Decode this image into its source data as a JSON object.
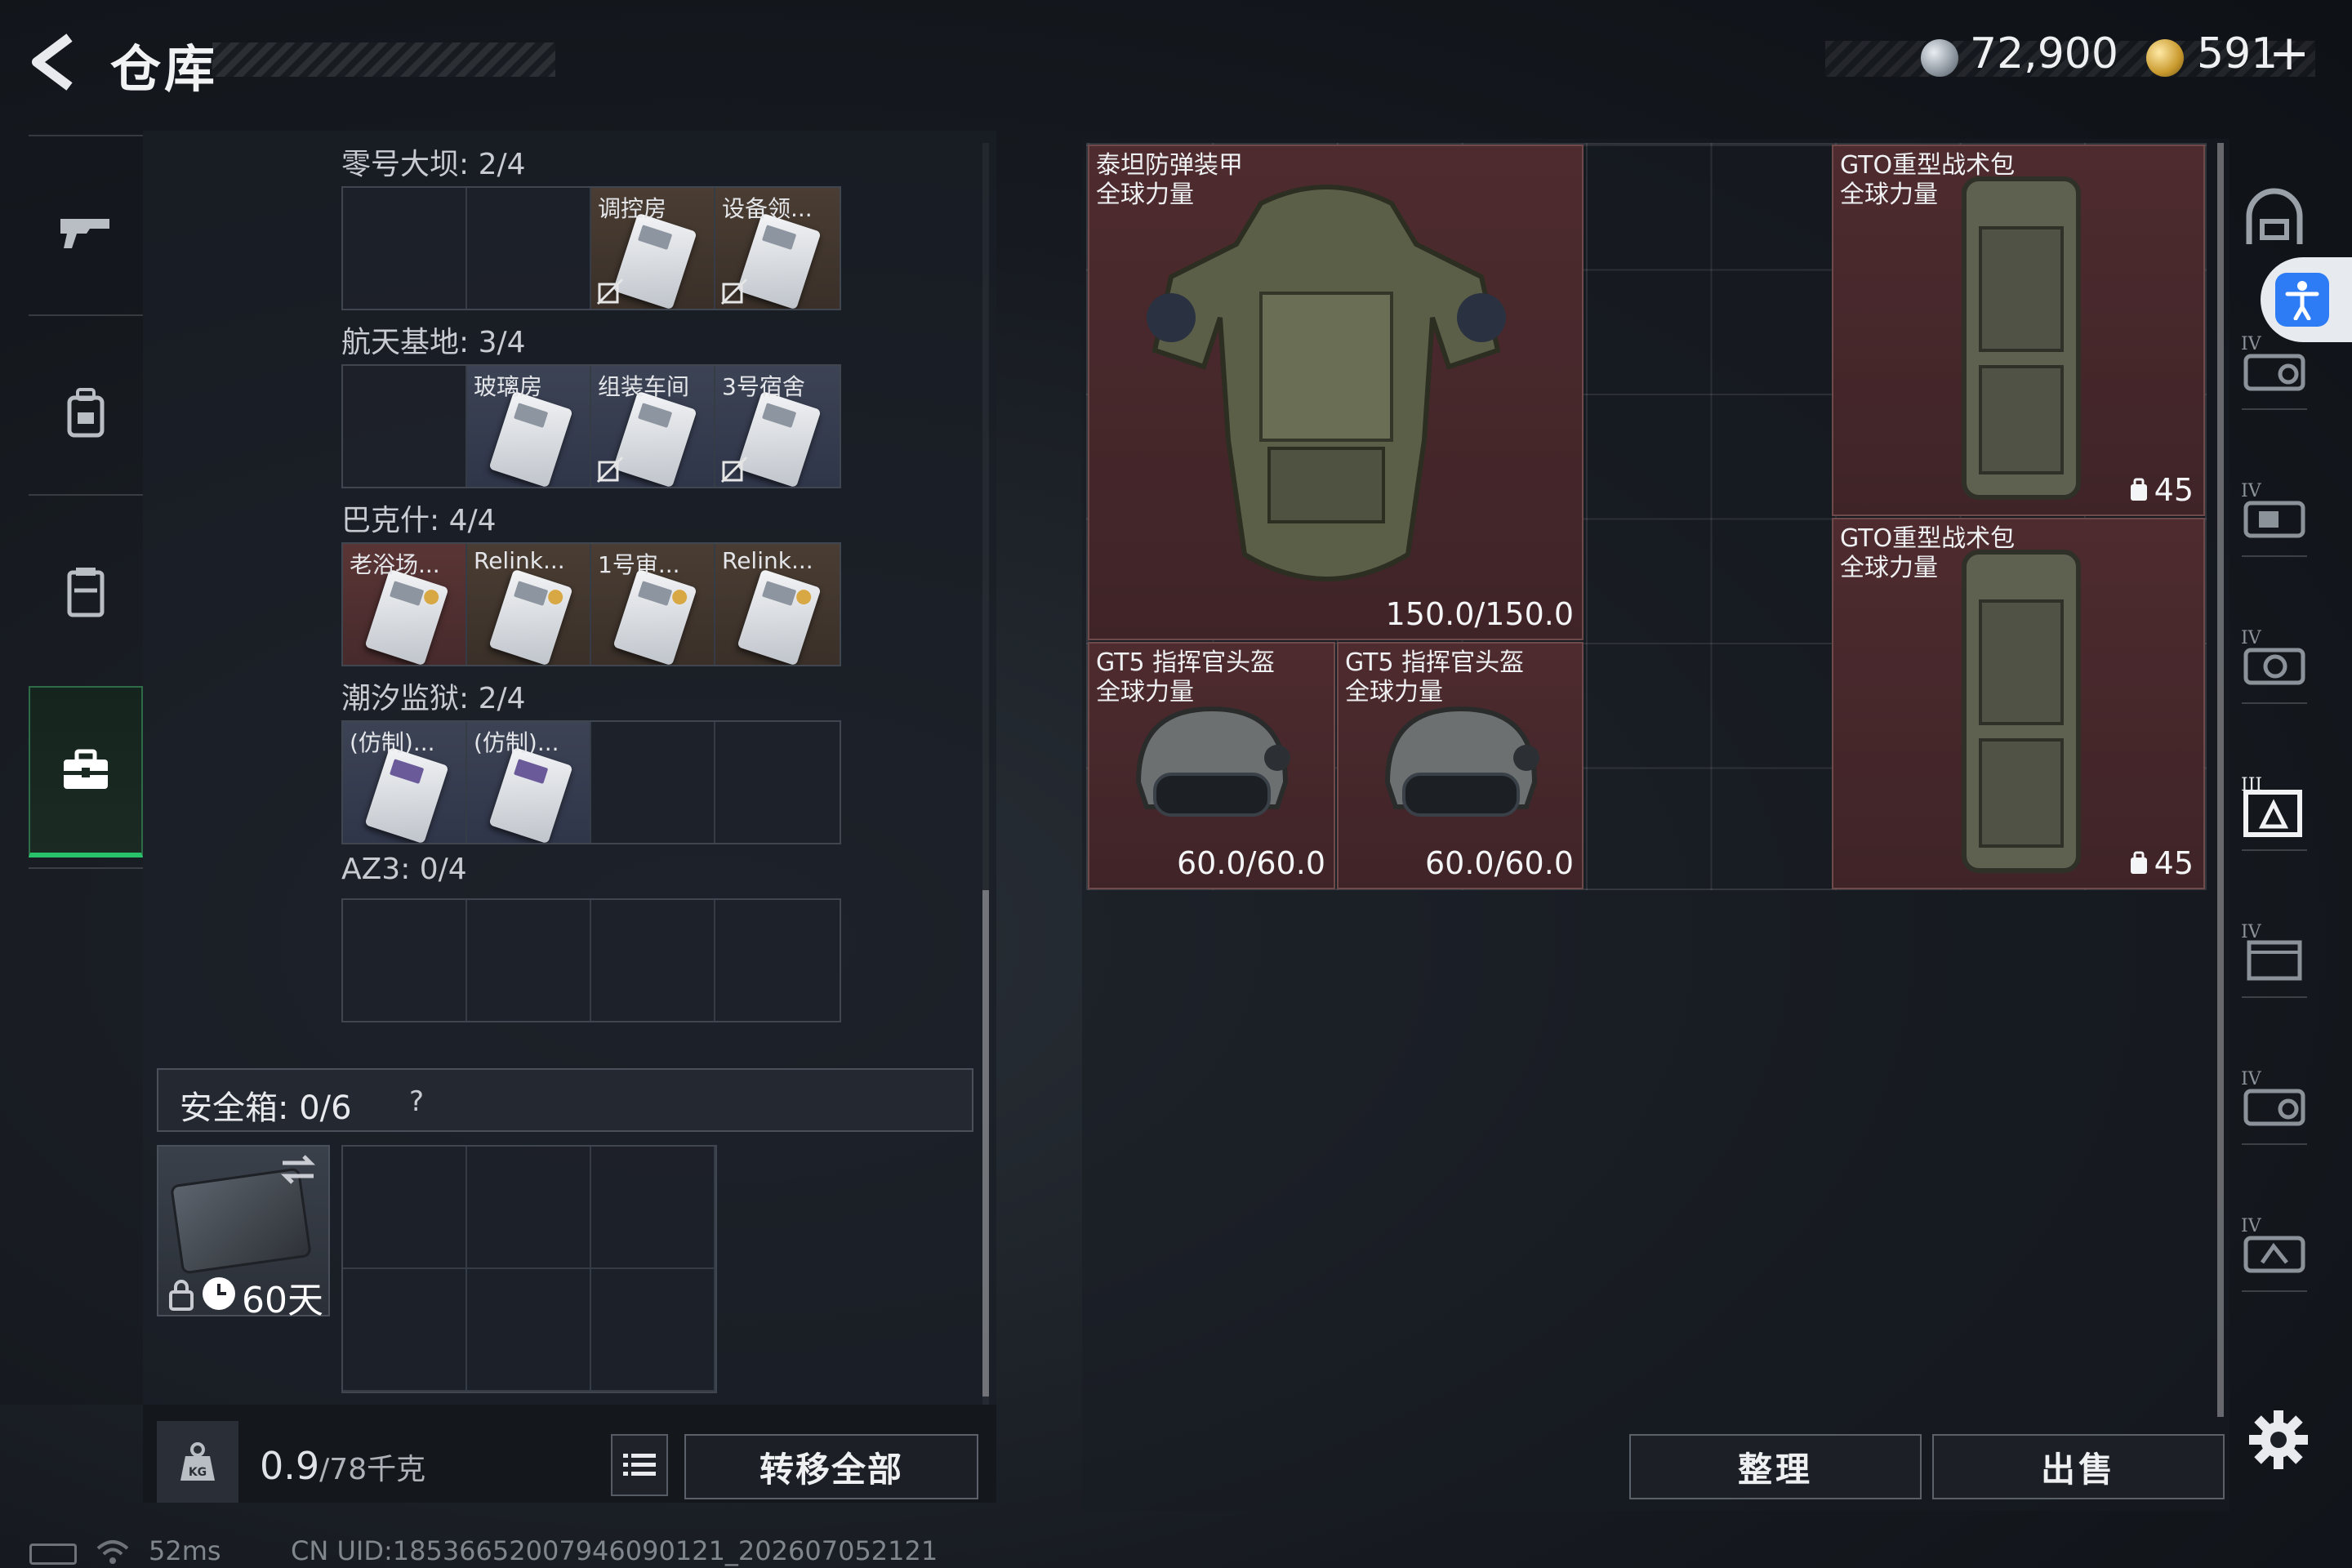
{
  "header": {
    "title": "仓库",
    "currency_silver": "72,900",
    "currency_gold": "591",
    "plus_label": "+"
  },
  "left_nav": {
    "items": [
      "gun",
      "backpack",
      "chest-rig",
      "toolbox"
    ],
    "active": "toolbox"
  },
  "key_groups": [
    {
      "title": "零号大坝: 2/4",
      "slots": [
        "",
        "",
        "调控房",
        "设备领..."
      ],
      "tones": [
        "empty",
        "empty",
        "brown",
        "brown"
      ],
      "nofit": [
        false,
        false,
        true,
        true
      ]
    },
    {
      "title": "航天基地: 3/4",
      "slots": [
        "",
        "玻璃房",
        "组装车间",
        "3号宿舍"
      ],
      "tones": [
        "empty",
        "blue",
        "blue",
        "blue"
      ],
      "nofit": [
        false,
        false,
        true,
        true
      ]
    },
    {
      "title": "巴克什: 4/4",
      "slots": [
        "老浴场...",
        "Relink...",
        "1号审...",
        "Relink..."
      ],
      "tones": [
        "red",
        "brown",
        "brown",
        "brown"
      ],
      "nofit": [
        false,
        false,
        false,
        false
      ]
    },
    {
      "title": "潮汐监狱: 2/4",
      "slots": [
        "(仿制)...",
        "(仿制)...",
        "",
        ""
      ],
      "tones": [
        "blue",
        "blue",
        "empty",
        "empty"
      ],
      "nofit": [
        false,
        false,
        false,
        false
      ]
    },
    {
      "title": "AZ3: 0/4",
      "slots": [
        "",
        "",
        "",
        ""
      ],
      "tones": [
        "empty",
        "empty",
        "empty",
        "empty"
      ],
      "nofit": [
        false,
        false,
        false,
        false
      ]
    }
  ],
  "safe_box": {
    "title": "安全箱:  0/6",
    "help": "?",
    "days": "60天"
  },
  "weight": {
    "current": "0.9",
    "max": "/78千克"
  },
  "buttons": {
    "transfer_all": "转移全部",
    "sort": "整理",
    "sell": "出售"
  },
  "stash_items": {
    "armor": {
      "name1": "泰坦防弹装甲",
      "name2": "全球力量",
      "durability": "150.0/150.0"
    },
    "backpack_1": {
      "name1": "GTO重型战术包",
      "name2": "全球力量",
      "slots": "45"
    },
    "backpack_2": {
      "name1": "GTO重型战术包",
      "name2": "全球力量",
      "slots": "45"
    },
    "helmet_1": {
      "name1": "GT5 指挥官头盔",
      "name2": "全球力量",
      "durability": "60.0/60.0"
    },
    "helmet_2": {
      "name1": "GT5 指挥官头盔",
      "name2": "全球力量",
      "durability": "60.0/60.0"
    }
  },
  "filters": {
    "tiers": [
      "IV",
      "IV",
      "IV",
      "III",
      "IV",
      "IV",
      "IV"
    ]
  },
  "status": {
    "ping": "52ms",
    "uid": "CN UID:1853665200794609012​1_202607052121"
  },
  "colors": {
    "accent_green": "#27c26a",
    "item_red_bg": "#4e2b2f",
    "a11y_blue": "#2d7cf6"
  }
}
